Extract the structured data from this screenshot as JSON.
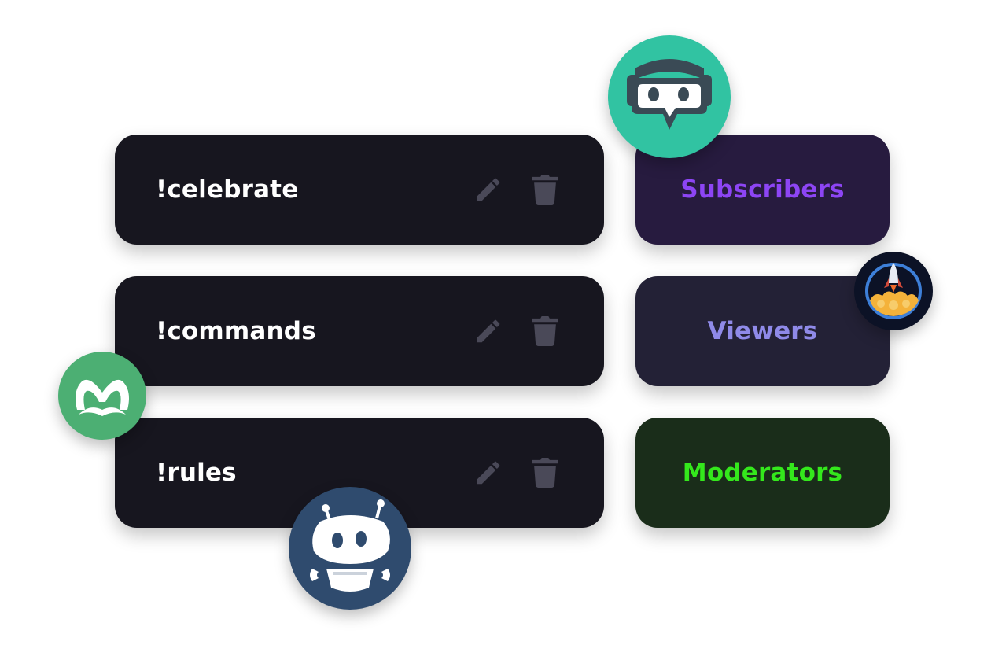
{
  "commands": [
    {
      "label": "!celebrate"
    },
    {
      "label": "!commands"
    },
    {
      "label": "!rules"
    }
  ],
  "roles": [
    {
      "label": "Subscribers",
      "text_color": "#8d45f4",
      "bg_color": "#271b3f"
    },
    {
      "label": "Viewers",
      "text_color": "#8f8ae8",
      "bg_color": "#232136"
    },
    {
      "label": "Moderators",
      "text_color": "#34e81c",
      "bg_color": "#1a2d1a"
    }
  ],
  "colors": {
    "command_card_bg": "#17161f",
    "command_text": "#ffffff",
    "action_icon": "#4a4958",
    "streamlabs_logo_bg": "#31c3a2",
    "robot_logo_bg": "#2f4b6e",
    "m_logo_bg": "#4caf73",
    "rocket_logo_bg": "#0c1226"
  },
  "icons": {
    "edit": "pencil-icon",
    "delete": "trash-icon",
    "logos": [
      "streamlabs-logo",
      "rocket-bot-logo",
      "m-bot-logo",
      "robot-bot-logo"
    ]
  }
}
